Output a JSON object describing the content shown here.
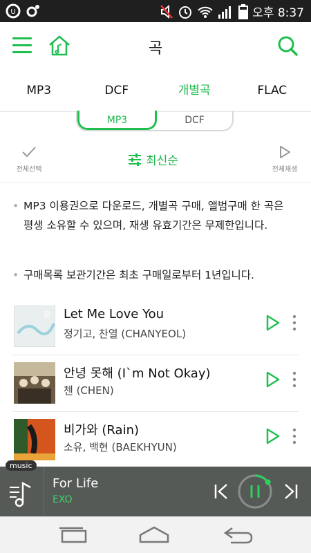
{
  "status_bar": {
    "time": "오후 8:37",
    "icons": [
      "u-plus-icon",
      "app-circle-icon",
      "mute-icon",
      "alarm-icon",
      "wifi-icon",
      "signal-icon",
      "battery-icon"
    ]
  },
  "header": {
    "title": "곡",
    "icons": {
      "menu": "hamburger-menu-icon",
      "home": "home-music-icon",
      "search": "search-icon"
    }
  },
  "tabs": [
    {
      "label": "MP3",
      "active": false
    },
    {
      "label": "DCF",
      "active": false
    },
    {
      "label": "개별곡",
      "active": true
    },
    {
      "label": "FLAC",
      "active": false
    }
  ],
  "segment": [
    {
      "label": "MP3",
      "active": true
    },
    {
      "label": "DCF",
      "active": false
    }
  ],
  "toolbar": {
    "select_all": "전체선택",
    "sort": "최신순",
    "play_all": "전체재생"
  },
  "notices": [
    "MP3 이용권으로 다운로드, 개별곡 구매, 앨범구매 한 곡은 평생 소유할 수 있으며, 재생 유효기간은 무제한입니다.",
    "구매목록 보관기간은 최초 구매일로부터 1년입니다."
  ],
  "songs": [
    {
      "title": "Let Me Love You",
      "artist": "정기고, 찬열 (CHANYEOL)"
    },
    {
      "title": "안녕 못해 (I`m Not Okay)",
      "artist": "첸 (CHEN)"
    },
    {
      "title": "비가와 (Rain)",
      "artist": "소유, 백현 (BAEKHYUN)"
    }
  ],
  "player": {
    "badge": "music",
    "title": "For Life",
    "artist": "EXO",
    "progress": 0.15
  },
  "colors": {
    "accent": "#1fbf4f",
    "status_bar": "#1f1f1f",
    "player_bg": "#555a57",
    "nav_bg": "#f2f2f2"
  }
}
